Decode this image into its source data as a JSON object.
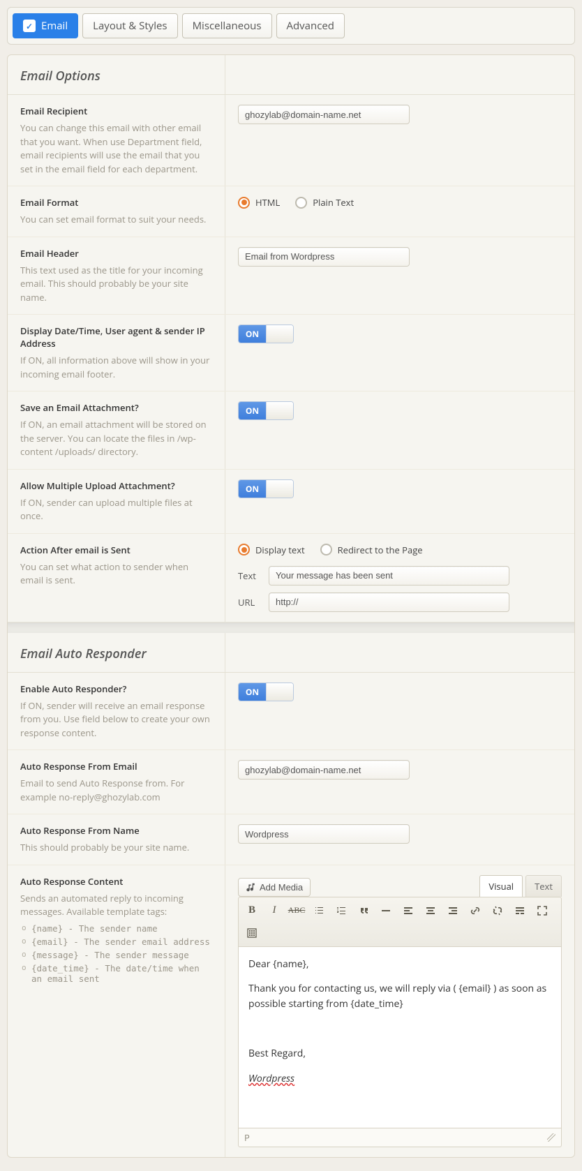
{
  "tabs": {
    "email": "Email",
    "layout": "Layout & Styles",
    "misc": "Miscellaneous",
    "advanced": "Advanced"
  },
  "sections": {
    "email_options": "Email Options",
    "auto_responder": "Email Auto Responder"
  },
  "fields": {
    "recipient": {
      "label": "Email Recipient",
      "desc": "You can change this email with other email that you want. When use Department field, email recipients will use the email that you set in the email field for each department.",
      "value": "ghozylab@domain-name.net"
    },
    "format": {
      "label": "Email Format",
      "desc": "You can set email format to suit your needs.",
      "options": {
        "html": "HTML",
        "plain": "Plain Text"
      }
    },
    "header": {
      "label": "Email Header",
      "desc": "This text used as the title for your incoming email. This should probably be your site name.",
      "value": "Email from Wordpress"
    },
    "datetime_ip": {
      "label": "Display Date/Time, User agent & sender IP Address",
      "desc": "If ON, all information above will show in your incoming email footer.",
      "on": "ON"
    },
    "save_attach": {
      "label": "Save an Email Attachment?",
      "desc": "If ON, an email attachment will be stored on the server. You can locate the files in /wp-content /uploads/ directory.",
      "on": "ON"
    },
    "multi_attach": {
      "label": "Allow Multiple Upload Attachment?",
      "desc": "If ON, sender can upload multiple files at once.",
      "on": "ON"
    },
    "action_after": {
      "label": "Action After email is Sent",
      "desc": "You can set what action to sender when email is sent.",
      "options": {
        "text": "Display text",
        "redirect": "Redirect to the Page"
      },
      "text_label": "Text",
      "text_value": "Your message has been sent",
      "url_label": "URL",
      "url_value": "http://"
    },
    "enable_ar": {
      "label": "Enable Auto Responder?",
      "desc": "If ON, sender will receive an email response from you. Use field below to create your own response content.",
      "on": "ON"
    },
    "ar_from_email": {
      "label": "Auto Response From Email",
      "desc": "Email to send Auto Response from. For example no-reply@ghozylab.com",
      "value": "ghozylab@domain-name.net"
    },
    "ar_from_name": {
      "label": "Auto Response From Name",
      "desc": "This should probably be your site name.",
      "value": "Wordpress"
    },
    "ar_content": {
      "label": "Auto Response Content",
      "desc": "Sends an automated reply to incoming messages. Available template tags:",
      "tags": {
        "name": "{name} - The sender name",
        "email": "{email} - The sender email address",
        "message": "{message} - The sender message",
        "date": "{date_time} - The date/time when an email sent"
      }
    }
  },
  "editor": {
    "add_media": "Add Media",
    "tab_visual": "Visual",
    "tab_text": "Text",
    "body_line1": "Dear {name},",
    "body_line2": "Thank you for contacting us, we will reply via ( {email} ) as soon as possible starting from {date_time}",
    "body_line3": "Best Regard,",
    "body_line4": "Wordpress",
    "status_path": "P"
  }
}
